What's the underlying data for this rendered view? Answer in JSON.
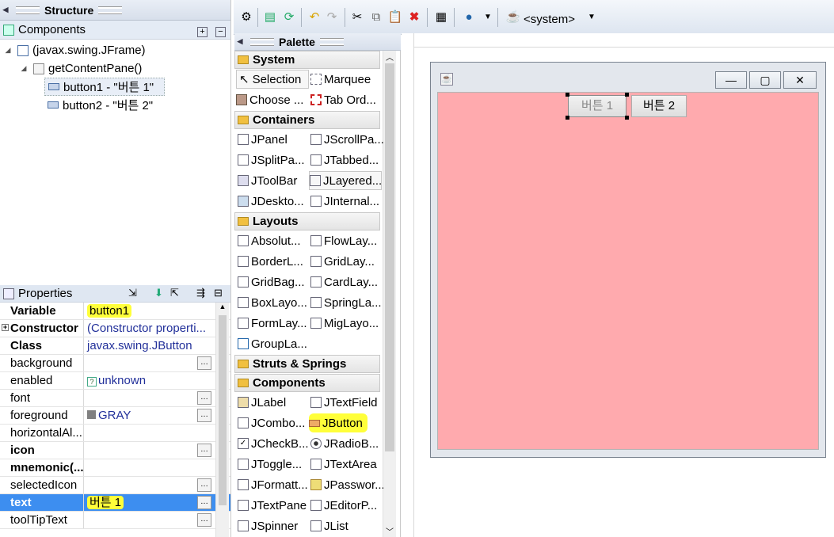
{
  "structure": {
    "title": "Structure",
    "components_label": "Components",
    "tree": [
      {
        "label": "(javax.swing.JFrame)"
      },
      {
        "label": "getContentPane()"
      },
      {
        "label": "button1 - \"버튼 1\""
      },
      {
        "label": "button2 - \"버튼 2\""
      }
    ]
  },
  "properties": {
    "title": "Properties",
    "rows": [
      {
        "name": "Variable",
        "value": "button1"
      },
      {
        "name": "Constructor",
        "value": "(Constructor properti..."
      },
      {
        "name": "Class",
        "value": "javax.swing.JButton"
      },
      {
        "name": "background",
        "value": ""
      },
      {
        "name": "enabled",
        "value": "unknown"
      },
      {
        "name": "font",
        "value": ""
      },
      {
        "name": "foreground",
        "value": "GRAY"
      },
      {
        "name": "horizontalAl...",
        "value": ""
      },
      {
        "name": "icon",
        "value": ""
      },
      {
        "name": "mnemonic(...",
        "value": ""
      },
      {
        "name": "selectedIcon",
        "value": ""
      },
      {
        "name": "text",
        "value": "버튼 1"
      },
      {
        "name": "toolTipText",
        "value": ""
      }
    ]
  },
  "toolbar": {
    "system_label": "<system>"
  },
  "palette": {
    "title": "Palette",
    "categories": {
      "system": "System",
      "containers": "Containers",
      "layouts": "Layouts",
      "struts": "Struts & Springs",
      "components": "Components"
    },
    "system_items": [
      "Selection",
      "Marquee",
      "Choose ...",
      "Tab Ord..."
    ],
    "container_items": [
      "JPanel",
      "JScrollPa...",
      "JSplitPa...",
      "JTabbed...",
      "JToolBar",
      "JLayered...",
      "JDeskto...",
      "JInternal..."
    ],
    "layout_items": [
      "Absolut...",
      "FlowLay...",
      "BorderL...",
      "GridLay...",
      "GridBag...",
      "CardLay...",
      "BoxLayo...",
      "SpringLa...",
      "FormLay...",
      "MigLayo...",
      "GroupLa..."
    ],
    "component_items": [
      "JLabel",
      "JTextField",
      "JCombo...",
      "JButton",
      "JCheckB...",
      "JRadioB...",
      "JToggle...",
      "JTextArea",
      "JFormatt...",
      "JPasswor...",
      "JTextPane",
      "JEditorP...",
      "JSpinner",
      "JList"
    ]
  },
  "design": {
    "button1": "버튼 1",
    "button2": "버튼 2",
    "content_color": "#ffaaae"
  }
}
